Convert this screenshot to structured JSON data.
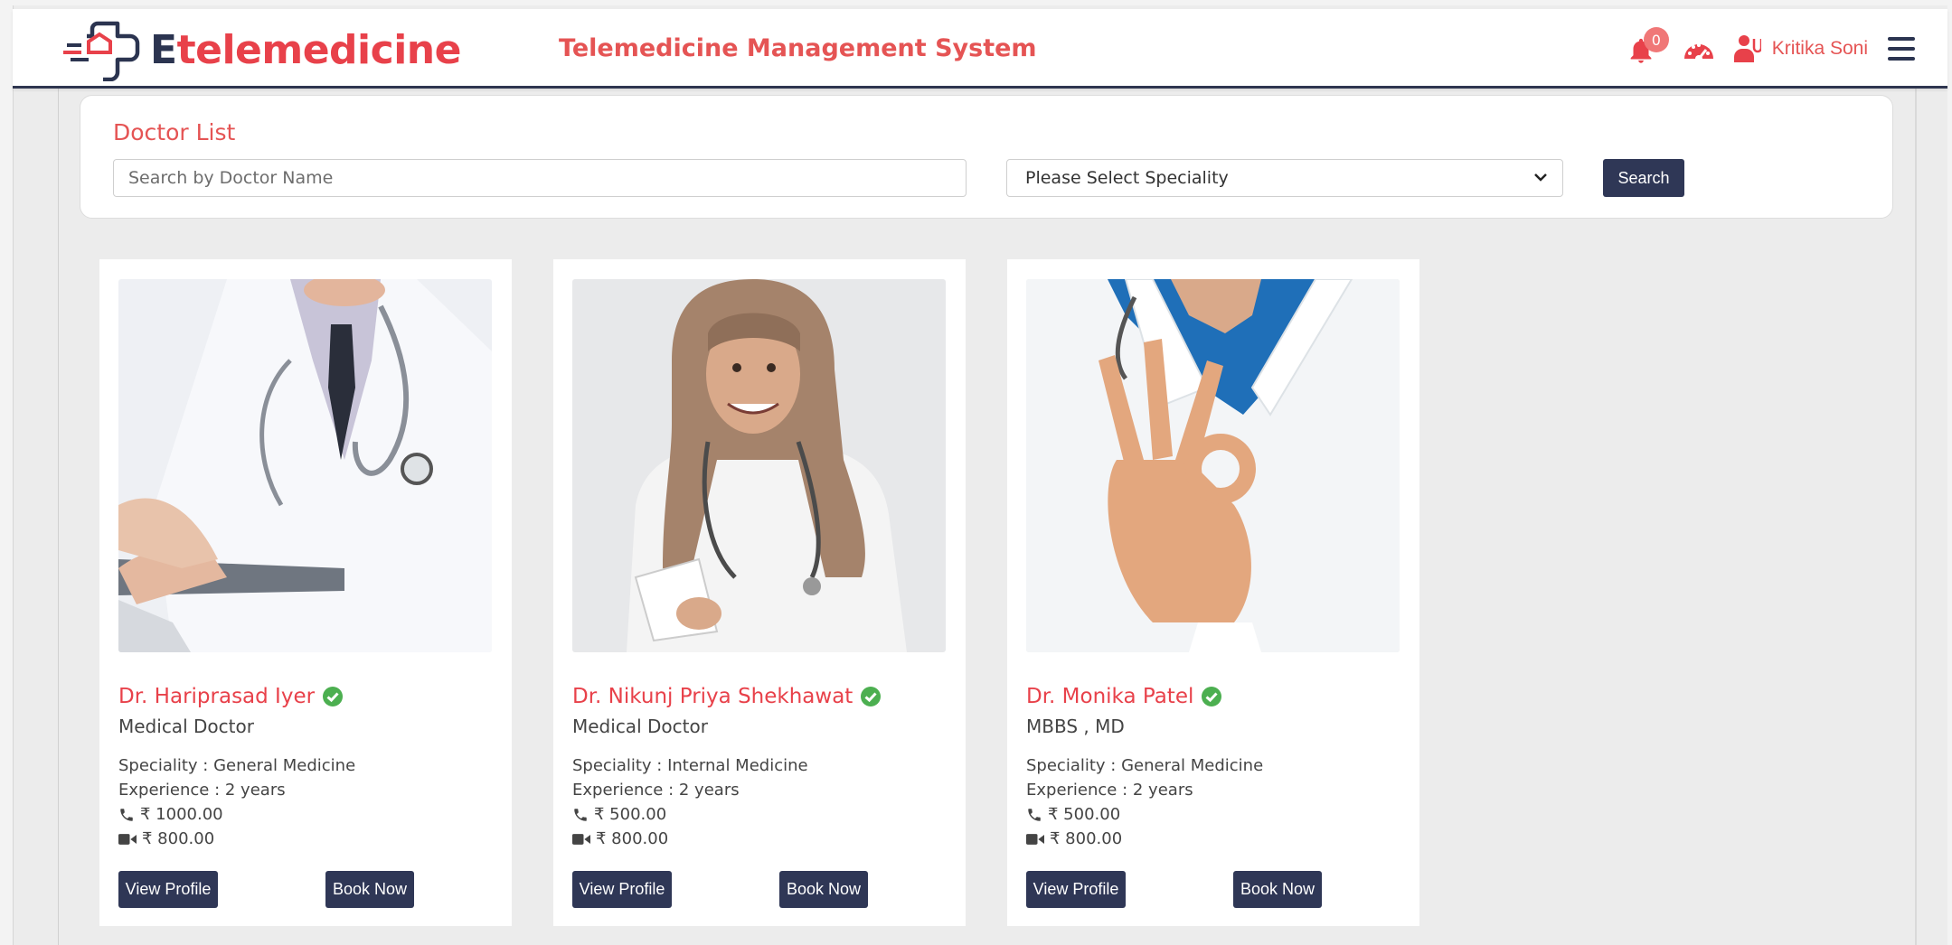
{
  "header": {
    "logo_first_letter": "E",
    "logo_rest": "telemedicine",
    "app_title": "Telemedicine Management System",
    "notification_count": "0",
    "user_name": "Kritika Soni"
  },
  "search": {
    "title": "Doctor List",
    "name_placeholder": "Search by Doctor Name",
    "speciality_selected": "Please Select Speciality",
    "button_label": "Search"
  },
  "doctors": [
    {
      "name": "Dr. Hariprasad Iyer",
      "title": "Medical Doctor",
      "speciality": "Speciality : General Medicine",
      "experience": "Experience : 2 years",
      "phone_fee": "₹ 1000.00",
      "video_fee": "₹ 800.00",
      "view_label": "View Profile",
      "book_label": "Book Now"
    },
    {
      "name": "Dr. Nikunj Priya Shekhawat",
      "title": "Medical Doctor",
      "speciality": "Speciality : Internal Medicine",
      "experience": "Experience : 2 years",
      "phone_fee": "₹ 500.00",
      "video_fee": "₹ 800.00",
      "view_label": "View Profile",
      "book_label": "Book Now"
    },
    {
      "name": "Dr. Monika Patel",
      "title": "MBBS , MD",
      "speciality": "Speciality : General Medicine",
      "experience": "Experience : 2 years",
      "phone_fee": "₹ 500.00",
      "video_fee": "₹ 800.00",
      "view_label": "View Profile",
      "book_label": "Book Now"
    }
  ],
  "colors": {
    "brand_red": "#e8414a",
    "navy": "#2f3756",
    "verified_green": "#4caf50"
  }
}
